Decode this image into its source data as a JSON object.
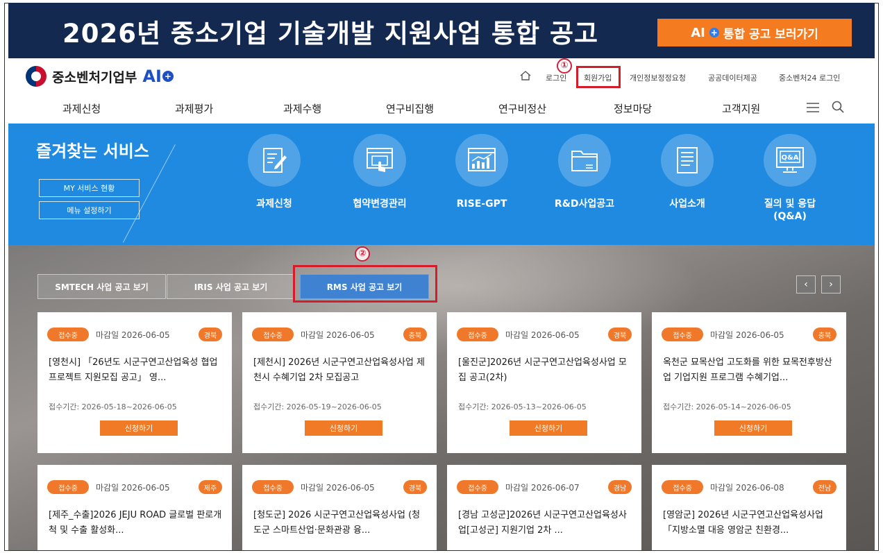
{
  "banner": {
    "title": "2026년 중소기업 기술개발 지원사업 통합 공고",
    "button_ai": "AI",
    "button_label": "통합 공고 보러가기"
  },
  "header": {
    "org_name": "중소벤처기업부",
    "ai_mark": "AI",
    "util": {
      "login": "로그인",
      "signup": "회원가입",
      "privacy": "개인정보정정요청",
      "public_data": "공공데이터제공",
      "sme24_login": "중소벤처24 로그인"
    },
    "markers": [
      "①",
      "②"
    ],
    "gnb": [
      "과제신청",
      "과제평가",
      "과제수행",
      "연구비집행",
      "연구비정산",
      "정보마당",
      "고객지원"
    ]
  },
  "favorites": {
    "title": "즐겨찾는 서비스",
    "my_service": "MY 서비스 현황",
    "menu_setting": "메뉴 설정하기",
    "items": [
      {
        "label": "과제신청",
        "icon": "edit-document-icon"
      },
      {
        "label": "협약변경관리",
        "icon": "touch-screen-icon"
      },
      {
        "label": "RISE-GPT",
        "icon": "chart-monitor-icon"
      },
      {
        "label": "R&D사업공고",
        "icon": "folder-icon"
      },
      {
        "label": "사업소개",
        "icon": "document-list-icon"
      },
      {
        "label": "질의 및 응답\n(Q&A)",
        "icon": "qa-monitor-icon"
      }
    ]
  },
  "announcements": {
    "tabs": [
      "SMTECH 사업 공고 보기",
      "IRIS 사업 공고 보기",
      "RMS 사업 공고 보기"
    ],
    "active_tab": "RMS 사업 공고 보기",
    "prev": "‹",
    "next": "›",
    "cards": [
      {
        "status": "접수중",
        "deadline": "마감일 2026-06-05",
        "region": "경북",
        "title": "[영천시] 「26년도 시군구연고산업육성 협업프로젝트 지원모집 공고」 영...",
        "period": "접수기간: 2026-05-18~2026-06-05",
        "apply": "신청하기"
      },
      {
        "status": "접수중",
        "deadline": "마감일 2026-06-05",
        "region": "충북",
        "title": "[제천시] 2026년 시군구연고산업육성사업 제천시 수혜기업 2차 모집공고",
        "period": "접수기간: 2026-05-19~2026-06-05",
        "apply": "신청하기"
      },
      {
        "status": "접수중",
        "deadline": "마감일 2026-06-05",
        "region": "경북",
        "title": "[울진군]2026년 시군구연고산업육성사업 모집 공고(2차)",
        "period": "접수기간: 2026-05-13~2026-06-05",
        "apply": "신청하기"
      },
      {
        "status": "접수중",
        "deadline": "마감일 2026-06-05",
        "region": "충북",
        "title": "옥천군 묘목산업 고도화를 위한 묘목전후방산업 기업지원 프로그램 수혜기업...",
        "period": "접수기간: 2026-05-14~2026-06-05",
        "apply": "신청하기"
      },
      {
        "status": "접수중",
        "deadline": "마감일 2026-06-05",
        "region": "제주",
        "title": "[제주_수출]2026 JEJU ROAD 글로벌 판로개척 및 수출 활성화...",
        "period": "",
        "apply": ""
      },
      {
        "status": "접수중",
        "deadline": "마감일 2026-06-05",
        "region": "경북",
        "title": "[청도군] 2026 시군구연고산업육성사업 (청도군 스마트산업·문화관광 융...",
        "period": "",
        "apply": ""
      },
      {
        "status": "접수중",
        "deadline": "마감일 2026-06-07",
        "region": "경남",
        "title": "[경남 고성군]2026년 시군구연고산업육성사업[고성군] 지원기업 2차 ...",
        "period": "",
        "apply": ""
      },
      {
        "status": "접수중",
        "deadline": "마감일 2026-06-08",
        "region": "전남",
        "title": "[영암군] 2026년 시군구연고산업육성사업「지방소멸 대응 영암군 친환경...",
        "period": "",
        "apply": ""
      }
    ]
  }
}
